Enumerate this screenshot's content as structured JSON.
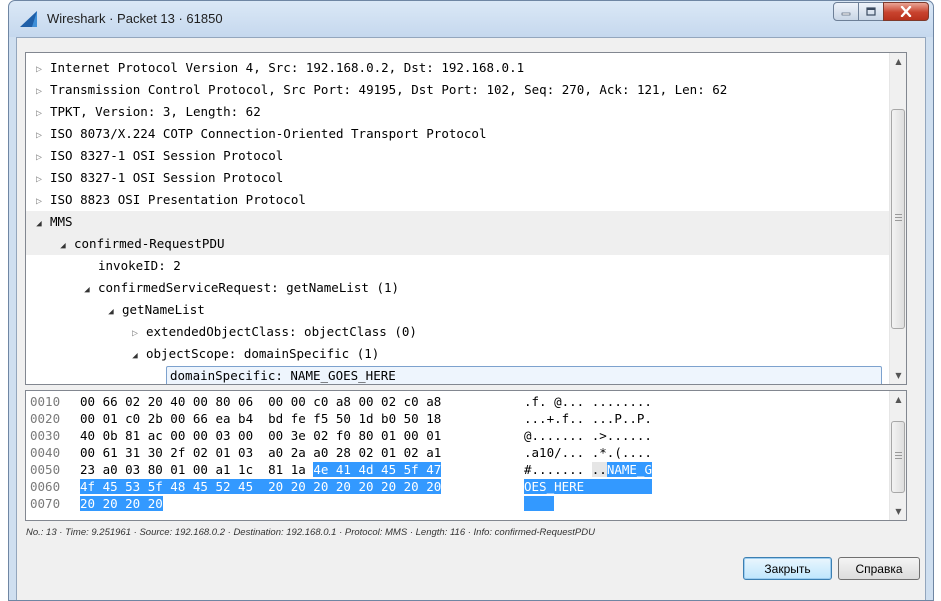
{
  "window": {
    "title": "Wireshark · Packet 13 · 61850"
  },
  "tree": {
    "rows": [
      {
        "text": "Internet Protocol Version 4, Src: 192.168.0.2, Dst: 192.168.0.1",
        "expander": "collapsed"
      },
      {
        "text": "Transmission Control Protocol, Src Port: 49195, Dst Port: 102, Seq: 270, Ack: 121, Len: 62",
        "expander": "collapsed"
      },
      {
        "text": "TPKT, Version: 3, Length: 62",
        "expander": "collapsed"
      },
      {
        "text": "ISO 8073/X.224 COTP Connection-Oriented Transport Protocol",
        "expander": "collapsed"
      },
      {
        "text": "ISO 8327-1 OSI Session Protocol",
        "expander": "collapsed"
      },
      {
        "text": "ISO 8327-1 OSI Session Protocol",
        "expander": "collapsed"
      },
      {
        "text": "ISO 8823 OSI Presentation Protocol",
        "expander": "collapsed"
      },
      {
        "text": "MMS",
        "expander": "expanded"
      },
      {
        "text": "confirmed-RequestPDU",
        "expander": "expanded"
      },
      {
        "text": "invokeID: 2",
        "expander": "none"
      },
      {
        "text": "confirmedServiceRequest: getNameList (1)",
        "expander": "expanded"
      },
      {
        "text": "getNameList",
        "expander": "expanded"
      },
      {
        "text": "extendedObjectClass: objectClass (0)",
        "expander": "collapsed"
      },
      {
        "text": "objectScope: domainSpecific (1)",
        "expander": "expanded"
      },
      {
        "text": "domainSpecific: NAME_GOES_HERE",
        "expander": "none",
        "selected": true
      }
    ]
  },
  "hex": {
    "rows": [
      {
        "offset": "0010",
        "bytes": [
          "00 66 02 20 40 00 80 06",
          "00 00 c0 a8 00 02 c0 a8"
        ],
        "ascii": [
          ".f. @...",
          "........"
        ]
      },
      {
        "offset": "0020",
        "bytes": [
          "00 01 c0 2b 00 66 ea b4",
          "bd fe f5 50 1d b0 50 18"
        ],
        "ascii": [
          "...+.f..",
          "...P..P."
        ]
      },
      {
        "offset": "0030",
        "bytes": [
          "40 0b 81 ac 00 00 03 00",
          "00 3e 02 f0 80 01 00 01"
        ],
        "ascii": [
          "@.......",
          ".>......"
        ]
      },
      {
        "offset": "0040",
        "bytes": [
          "00 61 31 30 2f 02 01 03",
          "a0 2a a0 28 02 01 02 a1"
        ],
        "ascii": [
          ".a10/...",
          ".*.(...."
        ]
      },
      {
        "offset": "0050",
        "bytes": [
          "23 a0 03 80 01 00 a1 1c",
          "81 1a",
          "4e 41 4d 45 5f 47"
        ],
        "ascii": [
          "#.......",
          "..",
          "NAME_G"
        ]
      },
      {
        "offset": "0060",
        "bytes": [
          "4f 45 53 5f 48 45 52 45",
          "20 20 20 20 20 20 20 20"
        ],
        "ascii": [
          "OES_HERE",
          "        "
        ]
      },
      {
        "offset": "0070",
        "bytes": [
          "20 20 20 20"
        ],
        "ascii": [
          "    "
        ]
      }
    ]
  },
  "status": {
    "text": "No.: 13 · Time: 9.251961 · Source: 192.168.0.2 · Destination: 192.168.0.1 · Protocol: MMS · Length: 116 · Info: confirmed-RequestPDU"
  },
  "buttons": {
    "close": "Закрыть",
    "help": "Справка"
  },
  "colors": {
    "selection": "#3399ff",
    "window_frame": "#cfdff0",
    "close_button": "#c8432e"
  },
  "icons": {
    "app": "wireshark-fin-icon",
    "minimize": "minimize-icon",
    "maximize": "maximize-icon",
    "close": "close-icon",
    "collapsed": "collapsed-triangle-icon",
    "expanded": "expanded-triangle-icon"
  }
}
